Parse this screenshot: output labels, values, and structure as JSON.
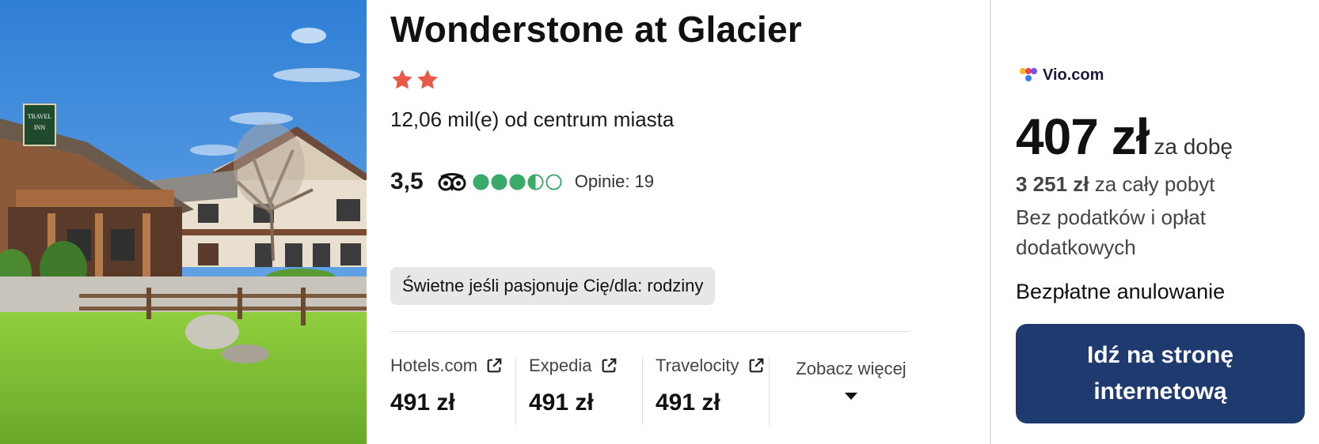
{
  "hotel": {
    "name": "Wonderstone at Glacier",
    "stars": 2,
    "distance": "12,06 mil(e) od centrum miasta",
    "rating": {
      "score": "3,5",
      "bubbles": 3.5,
      "reviews": "Opinie: 19"
    },
    "tag": "Świetne jeśli pasjonuje Cię/dla: rodziny",
    "photo_sign": {
      "line1": "TRAVEL",
      "line2": "INN"
    }
  },
  "providers": [
    {
      "name": "Hotels.com",
      "price": "491 zł"
    },
    {
      "name": "Expedia",
      "price": "491 zł"
    },
    {
      "name": "Travelocity",
      "price": "491 zł"
    }
  ],
  "more_label": "Zobacz więcej",
  "deal": {
    "provider": "Vio.com",
    "price": "407 zł",
    "per": "za dobę",
    "total_amount": "3 251 zł",
    "total_label": "za cały pobyt",
    "tax_note": "Bez podatków i opłat dodatkowych",
    "cancellation": "Bezpłatne anulowanie",
    "cta": "Idź na stronę internetową"
  },
  "colors": {
    "star": "#e8594a",
    "bubble": "#3aaa6b",
    "cta_bg": "#1e3a6e",
    "tag_bg": "#e6e7e9"
  },
  "icons": [
    "star-icon",
    "tripadvisor-owl-icon",
    "rating-bubble-icon",
    "external-link-icon",
    "caret-down-icon",
    "vio-logo-icon"
  ]
}
